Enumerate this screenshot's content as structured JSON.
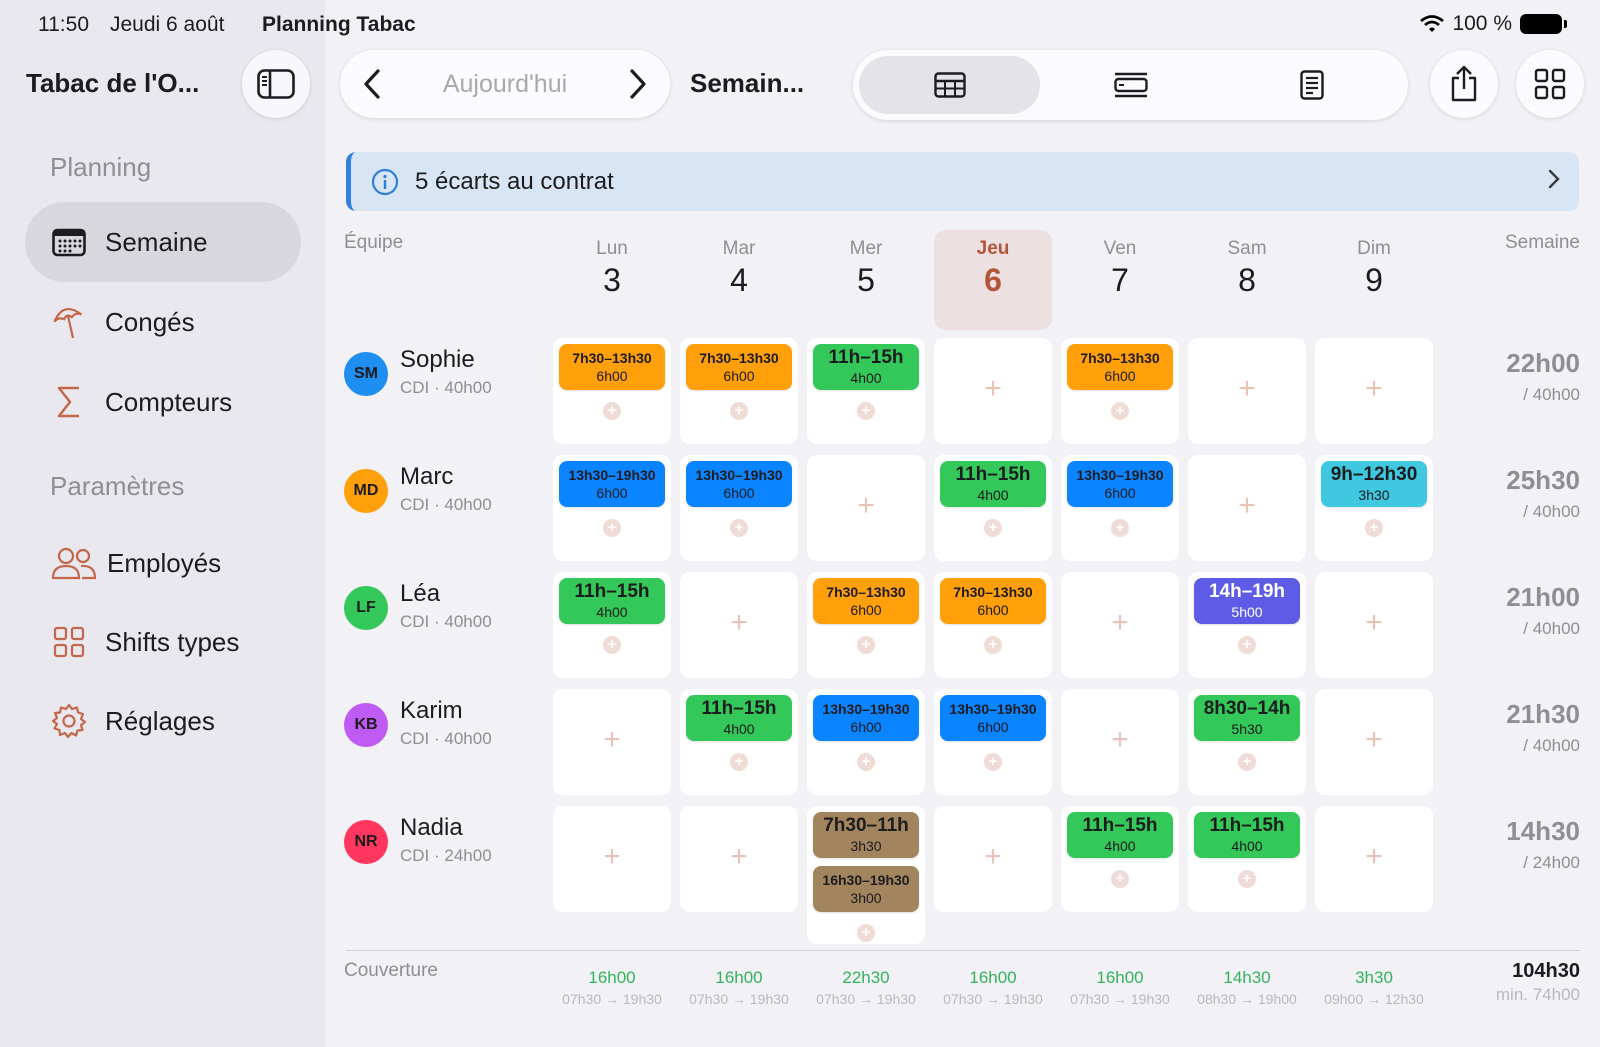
{
  "status_bar": {
    "time": "11:50",
    "date": "Jeudi 6 août",
    "app": "Planning Tabac",
    "battery": "100 %"
  },
  "sidebar": {
    "title": "Tabac de l'O...",
    "section_planning": "Planning",
    "section_params": "Paramètres",
    "items": [
      {
        "label": "Semaine",
        "icon": "calendar-icon"
      },
      {
        "label": "Congés",
        "icon": "umbrella-icon"
      },
      {
        "label": "Compteurs",
        "icon": "sigma-icon"
      },
      {
        "label": "Employés",
        "icon": "people-icon"
      },
      {
        "label": "Shifts types",
        "icon": "grid-icon"
      },
      {
        "label": "Réglages",
        "icon": "gear-icon"
      }
    ]
  },
  "toolbar": {
    "today": "Aujourd'hui",
    "view_title": "Semain..."
  },
  "banner": {
    "text": "5 écarts au contrat"
  },
  "grid": {
    "team_header": "Équipe",
    "week_header": "Semaine",
    "days": [
      {
        "name": "Lun",
        "num": "3"
      },
      {
        "name": "Mar",
        "num": "4"
      },
      {
        "name": "Mer",
        "num": "5"
      },
      {
        "name": "Jeu",
        "num": "6",
        "today": true
      },
      {
        "name": "Ven",
        "num": "7"
      },
      {
        "name": "Sam",
        "num": "8"
      },
      {
        "name": "Dim",
        "num": "9"
      }
    ],
    "employees": [
      {
        "initials": "SM",
        "name": "Sophie",
        "contract": "CDI · 40h00",
        "avatar_color": "#1f8ef1",
        "total": "22h00",
        "target": "/ 40h00",
        "days": [
          [
            {
              "time": "7h30–13h30",
              "dur": "6h00",
              "color": "#ff9f0a"
            }
          ],
          [
            {
              "time": "7h30–13h30",
              "dur": "6h00",
              "color": "#ff9f0a"
            }
          ],
          [
            {
              "time": "11h–15h",
              "dur": "4h00",
              "color": "#34c759",
              "big": true
            }
          ],
          [],
          [
            {
              "time": "7h30–13h30",
              "dur": "6h00",
              "color": "#ff9f0a"
            }
          ],
          [],
          []
        ]
      },
      {
        "initials": "MD",
        "name": "Marc",
        "contract": "CDI · 40h00",
        "avatar_color": "#ff9f0a",
        "total": "25h30",
        "target": "/ 40h00",
        "days": [
          [
            {
              "time": "13h30–19h30",
              "dur": "6h00",
              "color": "#0a84ff"
            }
          ],
          [
            {
              "time": "13h30–19h30",
              "dur": "6h00",
              "color": "#0a84ff"
            }
          ],
          [],
          [
            {
              "time": "11h–15h",
              "dur": "4h00",
              "color": "#34c759",
              "big": true
            }
          ],
          [
            {
              "time": "13h30–19h30",
              "dur": "6h00",
              "color": "#0a84ff"
            }
          ],
          [],
          [
            {
              "time": "9h–12h30",
              "dur": "3h30",
              "color": "#40c8e0",
              "big": true
            }
          ]
        ]
      },
      {
        "initials": "LF",
        "name": "Léa",
        "contract": "CDI · 40h00",
        "avatar_color": "#34c759",
        "total": "21h00",
        "target": "/ 40h00",
        "days": [
          [
            {
              "time": "11h–15h",
              "dur": "4h00",
              "color": "#34c759",
              "big": true
            }
          ],
          [],
          [
            {
              "time": "7h30–13h30",
              "dur": "6h00",
              "color": "#ff9f0a"
            }
          ],
          [
            {
              "time": "7h30–13h30",
              "dur": "6h00",
              "color": "#ff9f0a"
            }
          ],
          [],
          [
            {
              "time": "14h–19h",
              "dur": "5h00",
              "color": "#5e5ce6",
              "big": true,
              "light": true
            }
          ],
          []
        ]
      },
      {
        "initials": "KB",
        "name": "Karim",
        "contract": "CDI · 40h00",
        "avatar_color": "#bf5af2",
        "total": "21h30",
        "target": "/ 40h00",
        "days": [
          [],
          [
            {
              "time": "11h–15h",
              "dur": "4h00",
              "color": "#34c759",
              "big": true
            }
          ],
          [
            {
              "time": "13h30–19h30",
              "dur": "6h00",
              "color": "#0a84ff"
            }
          ],
          [
            {
              "time": "13h30–19h30",
              "dur": "6h00",
              "color": "#0a84ff"
            }
          ],
          [],
          [
            {
              "time": "8h30–14h",
              "dur": "5h30",
              "color": "#34c759",
              "big": true
            }
          ],
          []
        ]
      },
      {
        "initials": "NR",
        "name": "Nadia",
        "contract": "CDI · 24h00",
        "avatar_color": "#ff375f",
        "total": "14h30",
        "target": "/ 24h00",
        "days": [
          [],
          [],
          [
            {
              "time": "7h30–11h",
              "dur": "3h30",
              "color": "#a2845e",
              "big": true
            },
            {
              "time": "16h30–19h30",
              "dur": "3h00",
              "color": "#a2845e"
            }
          ],
          [],
          [
            {
              "time": "11h–15h",
              "dur": "4h00",
              "color": "#34c759",
              "big": true
            }
          ],
          [
            {
              "time": "11h–15h",
              "dur": "4h00",
              "color": "#34c759",
              "big": true
            }
          ],
          []
        ]
      }
    ],
    "coverage_label": "Couverture",
    "coverage": [
      {
        "hours": "16h00",
        "range": "07h30 → 19h30"
      },
      {
        "hours": "16h00",
        "range": "07h30 → 19h30"
      },
      {
        "hours": "22h30",
        "range": "07h30 → 19h30"
      },
      {
        "hours": "16h00",
        "range": "07h30 → 19h30"
      },
      {
        "hours": "16h00",
        "range": "07h30 → 19h30"
      },
      {
        "hours": "14h30",
        "range": "08h30 → 19h00"
      },
      {
        "hours": "3h30",
        "range": "09h00 → 12h30"
      }
    ],
    "coverage_total": "104h30",
    "coverage_min": "min. 74h00"
  }
}
